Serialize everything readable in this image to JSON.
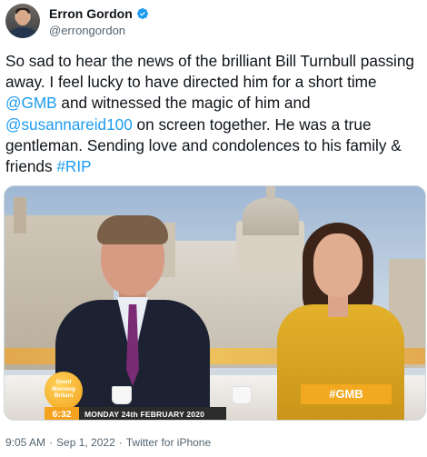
{
  "author": {
    "display_name": "Erron Gordon",
    "handle": "@errongordon",
    "verified": true,
    "avatar_icon": "profile-photo"
  },
  "tweet": {
    "text_parts": [
      {
        "text": "So sad to hear the news of the brilliant Bill Turnbull passing away. I feel lucky to have directed him for a short time ",
        "link": false
      },
      {
        "text": "@GMB",
        "link": true
      },
      {
        "text": " and witnessed the magic of him and ",
        "link": false
      },
      {
        "text": "@susannareid100",
        "link": true
      },
      {
        "text": " on screen together. He was a true gentleman. Sending love and condolences to his family & friends ",
        "link": false
      },
      {
        "text": "#RIP",
        "link": true
      }
    ]
  },
  "media": {
    "logo_text": "Good\nMorning\nBritain",
    "clock": "6:32",
    "date_banner": "MONDAY 24th FEBRUARY 2020",
    "hashtag": "#GMB"
  },
  "meta": {
    "time": "9:05 AM",
    "separator": "·",
    "date": "Sep 1, 2022",
    "source": "Twitter for iPhone"
  },
  "colors": {
    "link": "#1d9bf0",
    "verified": "#1d9bf0",
    "secondary_text": "#536471"
  }
}
